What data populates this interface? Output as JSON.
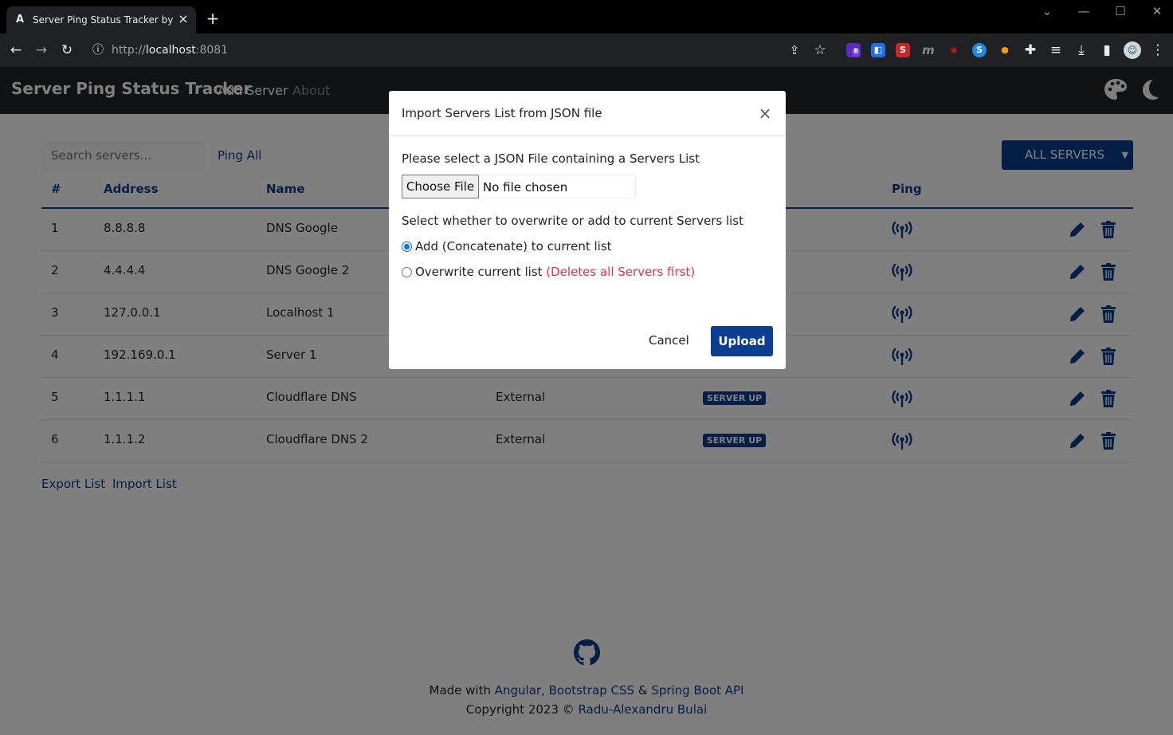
{
  "browser": {
    "tab_title": "Server Ping Status Tracker by Radu-Alexandru Bulai",
    "url_scheme": "http://",
    "url_host": "localhost",
    "url_port": ":8081",
    "extension_badge": "8"
  },
  "navbar": {
    "brand": "Server Ping Status Tracker",
    "links": [
      "Add Server",
      "About"
    ]
  },
  "toolbar": {
    "search_placeholder": "Search servers...",
    "ping_all": "Ping All",
    "filter": "ALL SERVERS"
  },
  "table": {
    "columns": [
      "#",
      "Address",
      "Name",
      "Ping"
    ],
    "rows": [
      {
        "n": "1",
        "address": "8.8.8.8",
        "name": "DNS Google",
        "type": "",
        "status": ""
      },
      {
        "n": "2",
        "address": "4.4.4.4",
        "name": "DNS Google 2",
        "type": "",
        "status": ""
      },
      {
        "n": "3",
        "address": "127.0.0.1",
        "name": "Localhost 1",
        "type": "",
        "status": ""
      },
      {
        "n": "4",
        "address": "192.169.0.1",
        "name": "Server 1",
        "type": "",
        "status": ""
      },
      {
        "n": "5",
        "address": "1.1.1.1",
        "name": "Cloudflare DNS",
        "type": "External",
        "status": "SERVER UP"
      },
      {
        "n": "6",
        "address": "1.1.1.2",
        "name": "Cloudflare DNS 2",
        "type": "External",
        "status": "SERVER UP"
      }
    ]
  },
  "list_actions": {
    "export": "Export List",
    "import": "Import List"
  },
  "footer": {
    "made_with": "Made with",
    "tech1": "Angular,",
    "tech2": "Bootstrap CSS",
    "amp": "&",
    "tech3": "Spring Boot API",
    "copyright": "Copyright 2023 ©",
    "author": "Radu-Alexandru Bulai"
  },
  "modal": {
    "title": "Import Servers List from JSON file",
    "prompt": "Please select a JSON File containing a Servers List",
    "choose_file": "Choose File",
    "no_file": "No file chosen",
    "mode_prompt": "Select whether to overwrite or add to current Servers list",
    "option_add": "Add (Concatenate) to current list",
    "option_overwrite": "Overwrite current list",
    "overwrite_warning": "(Deletes all Servers first)",
    "cancel": "Cancel",
    "upload": "Upload"
  },
  "colors": {
    "primary": "#0b3d91",
    "navbar": "#212529",
    "danger": "#dc3545"
  }
}
